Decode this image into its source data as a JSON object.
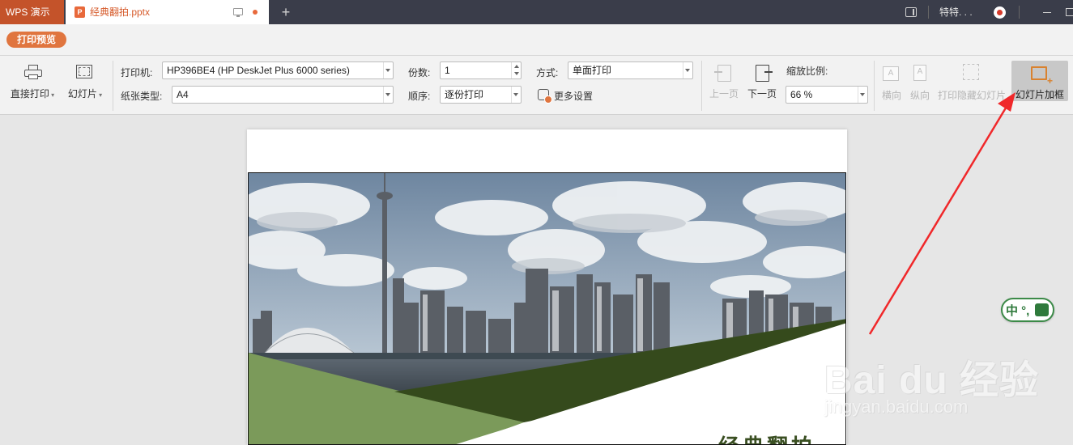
{
  "titlebar": {
    "app_tab": "WPS 演示",
    "doc_tab": "经典翻拍.pptx",
    "doc_icon_letter": "P",
    "new_tab": "+",
    "user_name": "特特. . .",
    "accent_color": "#c4532a"
  },
  "subbar": {
    "print_preview": "打印预览"
  },
  "toolbar": {
    "direct_print": "直接打印",
    "slides": "幻灯片",
    "printer_label": "打印机:",
    "printer_value": "HP396BE4 (HP DeskJet Plus 6000 series)",
    "paper_label": "纸张类型:",
    "paper_value": "A4",
    "copies_label": "份数:",
    "copies_value": "1",
    "order_label": "顺序:",
    "order_value": "逐份打印",
    "mode_label": "方式:",
    "mode_value": "单面打印",
    "more_settings": "更多设置",
    "prev_page": "上一页",
    "next_page": "下一页",
    "zoom_label": "缩放比例:",
    "zoom_value": "66 %",
    "landscape": "横向",
    "portrait": "纵向",
    "print_hidden": "打印隐藏幻灯片",
    "frame_slides": "幻灯片加框"
  },
  "slide": {
    "title": "经典翻拍",
    "green_dark": "#354a1c",
    "green_light": "#7b9a5a"
  },
  "overlays": {
    "ime_text": "中 °,",
    "watermark_big": "Bai du 经验",
    "watermark_small": "jingyan.baidu.com",
    "arrow_color": "#f0282a"
  }
}
